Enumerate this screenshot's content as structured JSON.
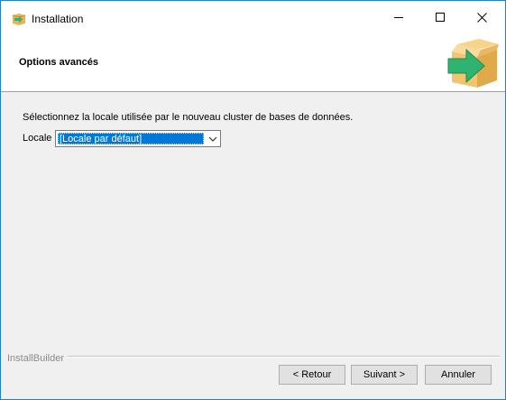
{
  "window": {
    "title": "Installation",
    "icon": "installer-box-arrow-icon"
  },
  "header": {
    "title": "Options avancés",
    "logo": "installer-box-arrow-icon"
  },
  "content": {
    "description": "Sélectionnez la locale utilisée par le nouveau cluster de bases de données.",
    "locale_label": "Locale",
    "locale_selected": "[Locale par défaut]"
  },
  "footer": {
    "brand": "InstallBuilder",
    "back_label": "< Retour",
    "next_label": "Suivant >",
    "cancel_label": "Annuler"
  },
  "colors": {
    "accent": "#0078d7",
    "box": "#f2c46d",
    "arrow": "#2fb370"
  }
}
